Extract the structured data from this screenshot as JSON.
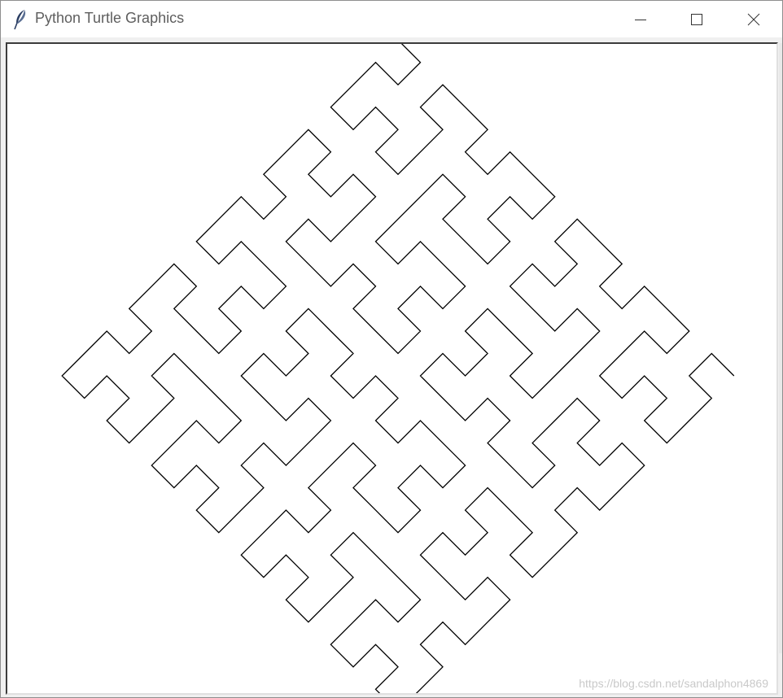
{
  "window": {
    "title": "Python Turtle Graphics",
    "icon": "feather-icon",
    "controls": {
      "minimize_icon": "minimize-icon",
      "maximize_icon": "maximize-icon",
      "close_icon": "close-icon"
    }
  },
  "canvas": {
    "background": "#ffffff",
    "pen_color": "#000000",
    "watermark": "https://blog.csdn.net/sandalphon4869"
  }
}
